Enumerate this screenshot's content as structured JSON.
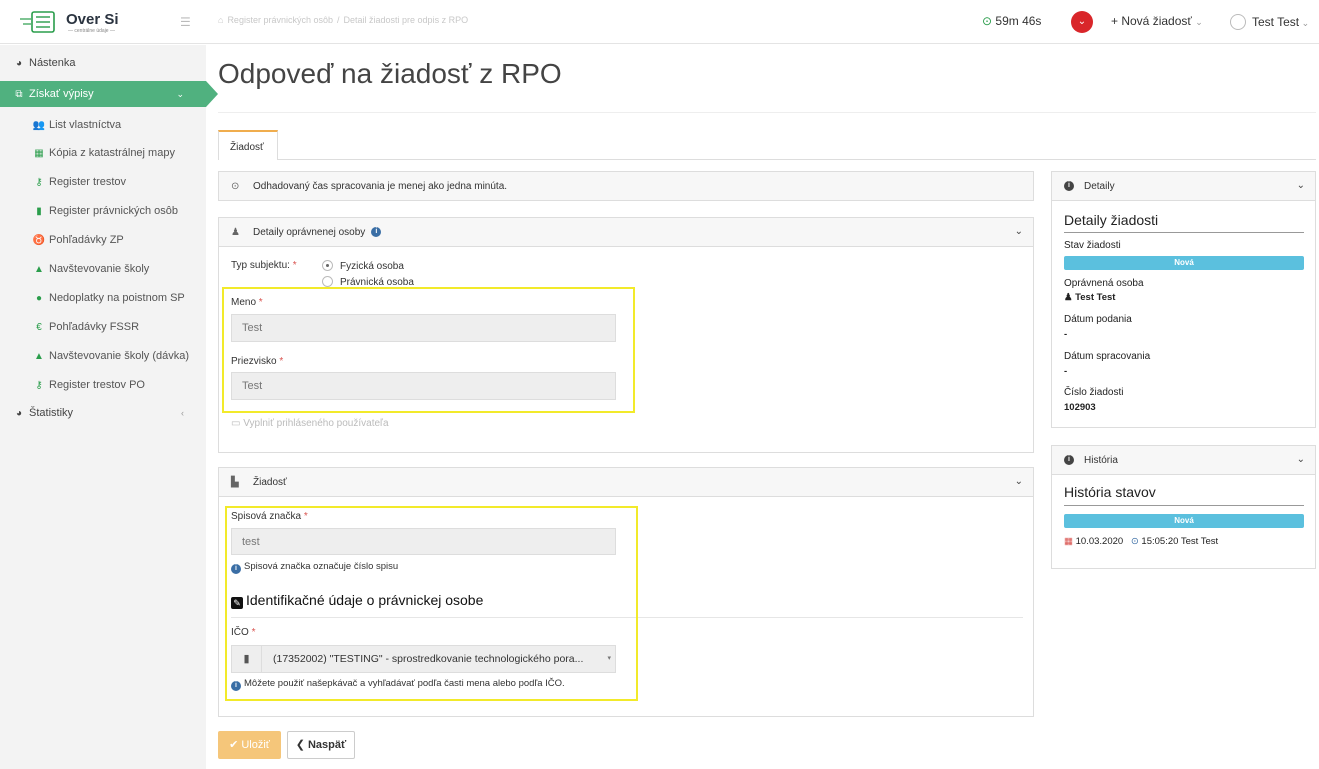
{
  "brand": {
    "name": "Over Si",
    "subtitle": "— centrálne údaje —"
  },
  "topbar": {
    "breadcrumb": [
      "Register právnických osôb",
      "/",
      "Detail žiadosti pre odpis z RPO"
    ],
    "timer": "59m 46s",
    "new_request": "+ Nová žiadosť",
    "user_name": "Test Test",
    "colors": {
      "notification": "#d9262a",
      "timer_icon": "#2a9d4b"
    }
  },
  "sidebar": {
    "accent": "#50b17f",
    "items": [
      {
        "label": "Nástenka",
        "icon": "dashboard-icon"
      },
      {
        "label": "Získať výpisy",
        "icon": "copy-icon"
      },
      {
        "label": "List vlastníctva",
        "icon": "users-icon"
      },
      {
        "label": "Kópia z katastrálnej mapy",
        "icon": "map-icon"
      },
      {
        "label": "Register trestov",
        "icon": "key-icon"
      },
      {
        "label": "Register právnických osôb",
        "icon": "building-icon"
      },
      {
        "label": "Pohľadávky ZP",
        "icon": "stethoscope-icon"
      },
      {
        "label": "Navštevovanie školy",
        "icon": "graduation-cap-icon"
      },
      {
        "label": "Nedoplatky na poistnom SP",
        "icon": "globe-icon"
      },
      {
        "label": "Pohľadávky FSSR",
        "icon": "euro-icon"
      },
      {
        "label": "Navštevovanie školy (dávka)",
        "icon": "graduation-cap-icon"
      },
      {
        "label": "Register trestov PO",
        "icon": "key-icon"
      },
      {
        "label": "Štatistiky",
        "icon": "dashboard-icon"
      }
    ]
  },
  "main": {
    "title": "Odpoveď na žiadosť z RPO",
    "tab": "Žiadosť",
    "notice": "Odhadovaný čas spracovania je menej ako jedna minúta.",
    "person_panel": {
      "title": "Detaily oprávnenej osoby",
      "subject_type_label": "Typ subjektu:",
      "subject_options": [
        "Fyzická osoba",
        "Právnická osoba"
      ],
      "selected_option": "Fyzická osoba",
      "name_label": "Meno",
      "name_value": "Test",
      "surname_label": "Priezvisko",
      "surname_value": "Test",
      "fill_logged_user": "Vyplniť prihláseného používateľa"
    },
    "request_panel": {
      "title": "Žiadosť",
      "file_mark_label": "Spisová značka",
      "file_mark_value": "test",
      "file_mark_hint": "Spisová značka označuje číslo spisu",
      "section_title": "Identifikačné údaje o právnickej osobe",
      "ico_label": "IČO",
      "ico_value": "(17352002) \"TESTING\" - sprostredkovanie technologického pora...",
      "ico_hint": "Môžete použiť našepkávač a vyhľadávať podľa časti mena alebo podľa IČO."
    },
    "buttons": {
      "save": "Uložiť",
      "back": "Naspäť"
    }
  },
  "details_panel": {
    "header": "Detaily",
    "title": "Detaily žiadosti",
    "status_label": "Stav žiadosti",
    "status_value": "Nová",
    "person_label": "Oprávnená osoba",
    "person_value": "Test Test",
    "submitted_label": "Dátum podania",
    "submitted_value": "-",
    "processed_label": "Dátum spracovania",
    "processed_value": "-",
    "number_label": "Číslo žiadosti",
    "number_value": "102903",
    "status_color": "#5bc0de"
  },
  "history_panel": {
    "header": "História",
    "title": "História stavov",
    "status_value": "Nová",
    "date": "10.03.2020",
    "time": "15:05:20 Test Test"
  }
}
